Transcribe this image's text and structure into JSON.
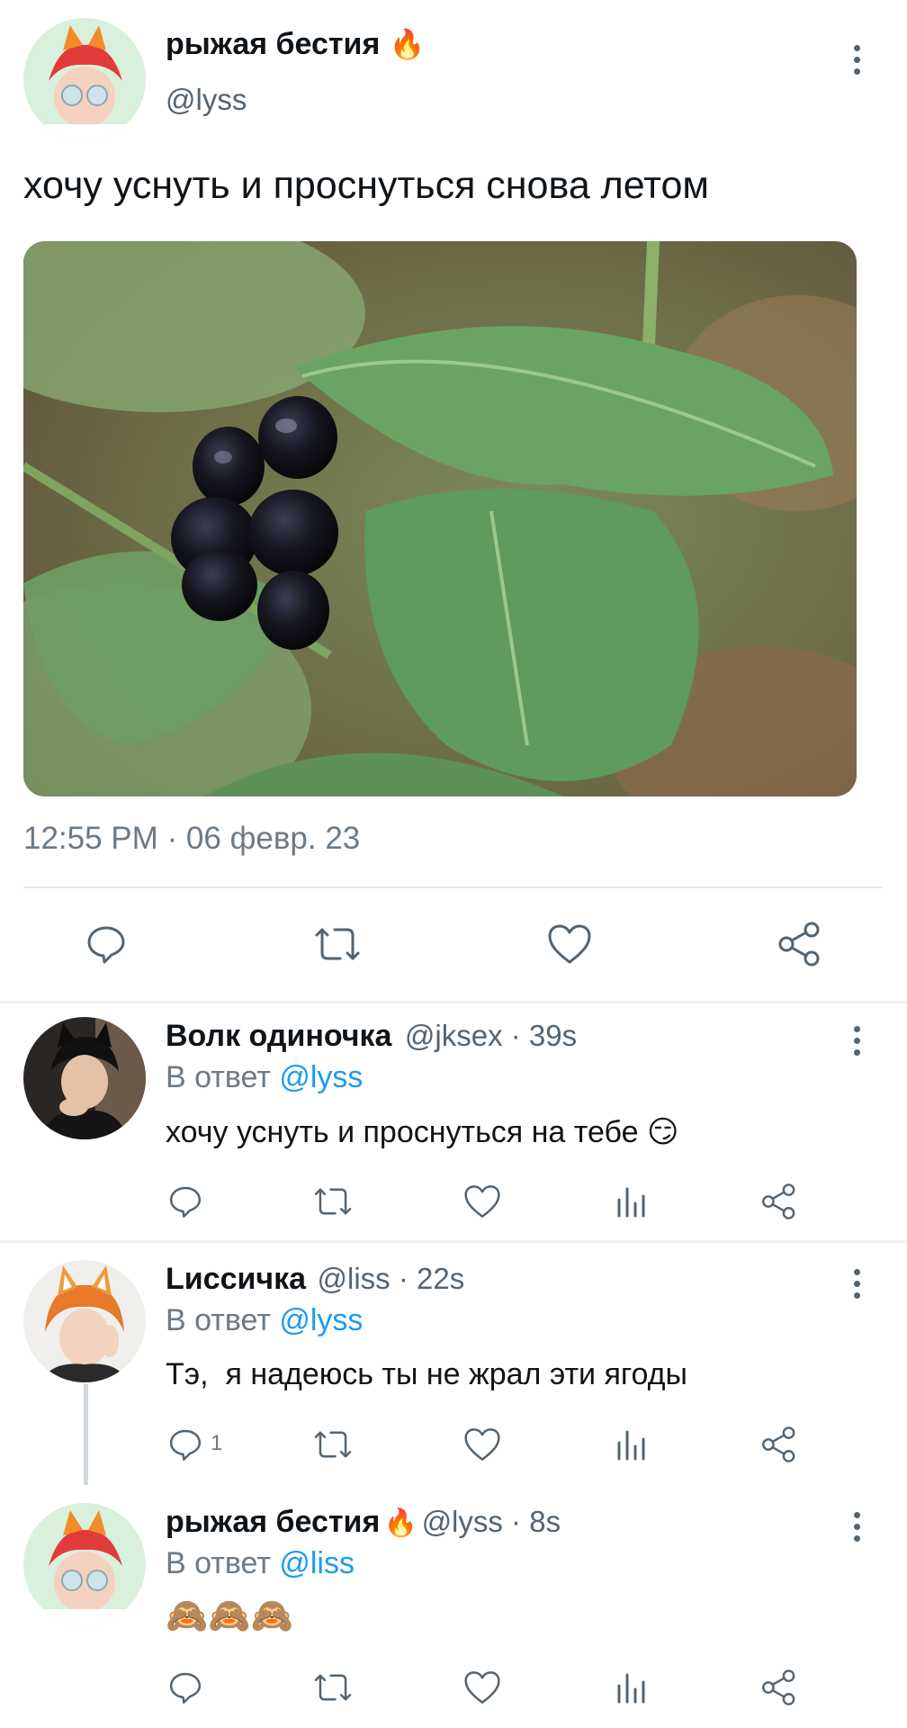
{
  "main_tweet": {
    "author_name": "рыжая бестия",
    "author_emoji": "🔥",
    "author_handle": "@lyss",
    "text": "хочу уснуть и проснуться снова летом",
    "timestamp": "12:55 PM · 06 февр. 23"
  },
  "replies": [
    {
      "author_name": "Волк одиночка",
      "handle_time": "@jksex · 39s",
      "reply_prefix": "В ответ",
      "reply_to": "@lyss",
      "text": "хочу уснуть и проснуться на тебе",
      "text_emoji": "😏",
      "reply_count": ""
    },
    {
      "author_name": "Lиссичка",
      "handle_time": "@liss · 22s",
      "reply_prefix": "В ответ",
      "reply_to": "@lyss",
      "text": "Тэ,  я надеюсь ты не жрал эти ягоды",
      "reply_count": "1"
    },
    {
      "author_name": "рыжая бестия",
      "author_emoji": "🔥",
      "handle_time": "@lyss · 8s",
      "reply_prefix": "В ответ",
      "reply_to": "@liss",
      "text": "🙈🙈🙈",
      "reply_count": ""
    }
  ],
  "icons": {
    "reply": "reply-icon",
    "retweet": "retweet-icon",
    "like": "heart-icon",
    "views": "views-icon",
    "share": "share-icon",
    "more": "more-icon"
  },
  "colors": {
    "link": "#1d9bf0",
    "secondary_text": "#536471",
    "divider": "#e7ebee"
  }
}
